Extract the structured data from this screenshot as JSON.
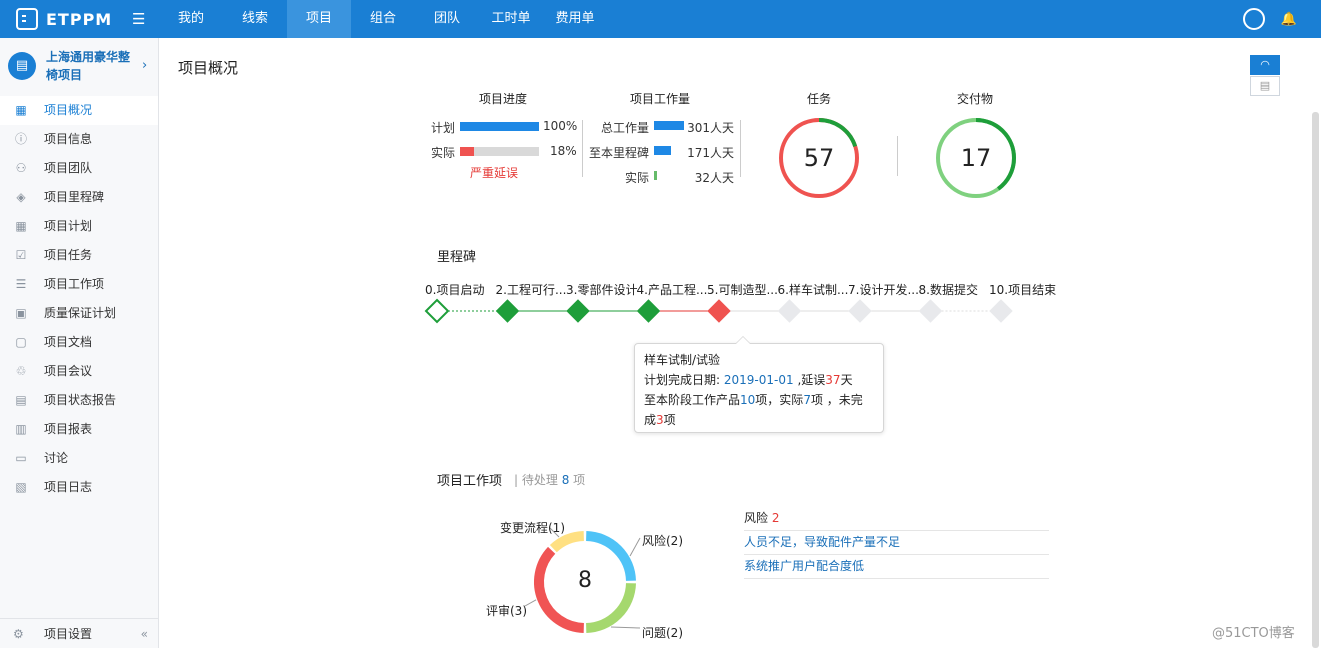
{
  "app": {
    "logo": "ETPPM"
  },
  "nav": {
    "items": [
      "我的",
      "线索",
      "项目",
      "组合",
      "团队",
      "工时单",
      "费用单"
    ],
    "active_index": 2
  },
  "sidebar": {
    "project_name": "上海通用豪华整椅项目",
    "items": [
      "项目概况",
      "项目信息",
      "项目团队",
      "项目里程碑",
      "项目计划",
      "项目任务",
      "项目工作项",
      "质量保证计划",
      "项目文档",
      "项目会议",
      "项目状态报告",
      "项目报表",
      "讨论",
      "项目日志"
    ],
    "active_index": 0,
    "settings_label": "项目设置"
  },
  "page": {
    "title": "项目概况"
  },
  "progress": {
    "title": "项目进度",
    "plan_label": "计划",
    "plan_value": "100%",
    "plan_fraction": 1.0,
    "actual_label": "实际",
    "actual_value": "18%",
    "actual_fraction": 0.18,
    "status": "严重延误"
  },
  "workload": {
    "title": "项目工作量",
    "rows": [
      {
        "label": "总工作量",
        "value": "301人天",
        "amount": 301,
        "color": "#1e88e5"
      },
      {
        "label": "至本里程碑",
        "value": "171人天",
        "amount": 171,
        "color": "#1e88e5"
      },
      {
        "label": "实际",
        "value": "32人天",
        "amount": 32,
        "color": "#66bb6a"
      }
    ]
  },
  "tasks": {
    "title": "任务",
    "count": "57",
    "done_fraction": 0.2
  },
  "deliverables": {
    "title": "交付物",
    "count": "17",
    "done_fraction": 0.4
  },
  "milestones": {
    "title": "里程碑",
    "items": [
      {
        "label": "0.项目启动",
        "state": "start"
      },
      {
        "label": "2.工程可行...",
        "state": "done"
      },
      {
        "label": "3.零部件设计",
        "state": "done"
      },
      {
        "label": "4.产品工程...",
        "state": "done"
      },
      {
        "label": "5.可制造型...",
        "state": "delayed"
      },
      {
        "label": "6.样车试制...",
        "state": "pending"
      },
      {
        "label": "7.设计开发...",
        "state": "pending"
      },
      {
        "label": "8.数据提交",
        "state": "pending"
      },
      {
        "label": "10.项目结束",
        "state": "pending"
      }
    ],
    "tooltip": {
      "name": "样车试制/试验",
      "date_label": "计划完成日期:",
      "date": "2019-01-01",
      "delay_prefix": ",延误",
      "delay_days": "37",
      "delay_unit": "天",
      "line2_prefix": "至本阶段工作产品",
      "planned": "10",
      "line2_mid": "项，实际",
      "actual": "7",
      "line2_suffix": "项 ，未完",
      "line3_prefix": "成",
      "undone": "3",
      "line3_suffix": "项"
    }
  },
  "work_items": {
    "title": "项目工作项",
    "pending_prefix": "待处理",
    "pending_count": "8",
    "pending_suffix": "项",
    "total": "8",
    "segments": [
      {
        "label": "风险(2)",
        "value": 2,
        "color": "#4fc3f7"
      },
      {
        "label": "问题(2)",
        "value": 2,
        "color": "#a5d86e"
      },
      {
        "label": "评审(3)",
        "value": 3,
        "color": "#f05454"
      },
      {
        "label": "变更流程(1)",
        "value": 1,
        "color": "#ffe082"
      }
    ]
  },
  "risks": {
    "label": "风险",
    "count": "2",
    "items": [
      "人员不足，导致配件产量不足",
      "系统推广用户配合度低"
    ]
  },
  "watermark": "@51CTO博客"
}
